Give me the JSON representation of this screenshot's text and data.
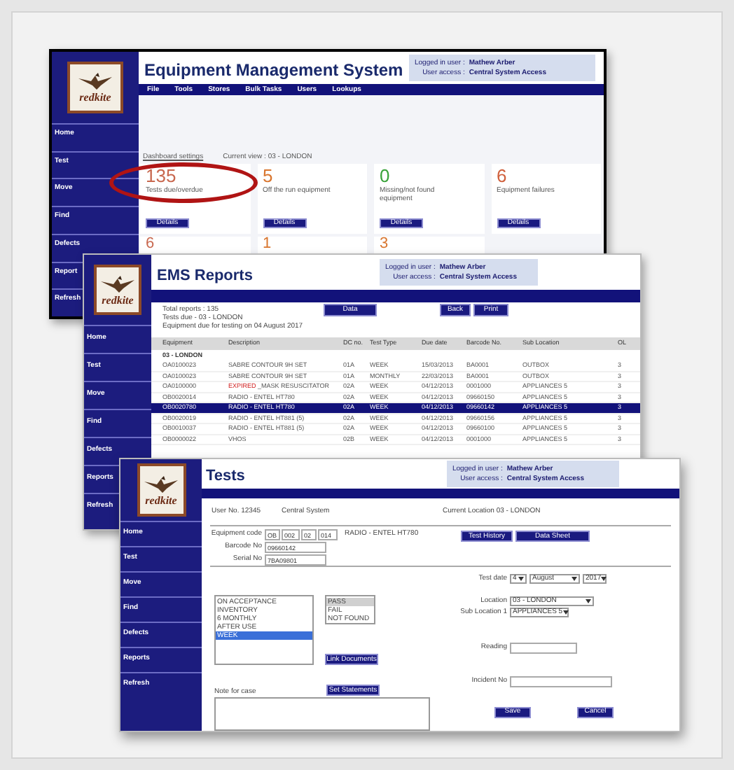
{
  "dashboard": {
    "logo_text": "redkite",
    "title": "Equipment Management System",
    "menu": [
      "File",
      "Tools",
      "Stores",
      "Bulk Tasks",
      "Users",
      "Lookups"
    ],
    "login": [
      {
        "label": "Logged in user :",
        "value": "Mathew Arber"
      },
      {
        "label": "User access :",
        "value": "Central System Access"
      }
    ],
    "sidebar": [
      "Home",
      "Test",
      "Move",
      "Find",
      "Defects",
      "Report",
      "Refresh"
    ],
    "settings_link": "Dashboard settings",
    "current_view": "Current view : 03 - LONDON",
    "cards": [
      {
        "value": "135",
        "label": "Tests due/overdue",
        "button": "Details",
        "color": "#c8684f"
      },
      {
        "value": "5",
        "label": "Off the run equipment",
        "button": "Details",
        "color": "#d9762f"
      },
      {
        "value": "0",
        "label": "Missing/not found equipment",
        "button": "Details",
        "color": "#3aa33a"
      },
      {
        "value": "6",
        "label": "Equipment failures",
        "button": "Details",
        "color": "#d0603c"
      }
    ],
    "cards_row2": [
      {
        "value": "6",
        "color": "#c8684f"
      },
      {
        "value": "1",
        "color": "#d9762f"
      },
      {
        "value": "3",
        "color": "#d9762f"
      }
    ]
  },
  "reports": {
    "logo_text": "redkite",
    "title": "EMS Reports",
    "login": [
      {
        "label": "Logged in user :",
        "value": "Mathew Arber"
      },
      {
        "label": "User access :",
        "value": "Central System Access"
      }
    ],
    "sidebar": [
      "Home",
      "Test",
      "Move",
      "Find",
      "Defects",
      "Reports",
      "Refresh"
    ],
    "summary": [
      "Total reports : 135",
      "Tests due - 03 - LONDON",
      "Equipment due for testing on 04 August 2017"
    ],
    "buttons": [
      "Data",
      "Back",
      "Print"
    ],
    "table": {
      "columns": [
        "Equipment",
        "Description",
        "DC no.",
        "Test Type",
        "Due date",
        "Barcode No.",
        "Sub Location",
        "OL"
      ],
      "group": "03 - LONDON",
      "rows": [
        {
          "cells": [
            "OA0100023",
            "SABRE CONTOUR 9H SET",
            "01A",
            "WEEK",
            "15/03/2013",
            "BA0001",
            "OUTBOX",
            "3"
          ],
          "selected": false
        },
        {
          "cells": [
            "OA0100023",
            "SABRE CONTOUR 9H SET",
            "01A",
            "MONTHLY",
            "22/03/2013",
            "BA0001",
            "OUTBOX",
            "3"
          ],
          "selected": false
        },
        {
          "cells": [
            "OA0100000",
            "_MASK RESUSCITATOR",
            "02A",
            "WEEK",
            "04/12/2013",
            "0001000",
            "APPLIANCES 5",
            "3"
          ],
          "flag": "EXPIRED",
          "selected": false
        },
        {
          "cells": [
            "OB0020014",
            "RADIO - ENTEL HT780",
            "02A",
            "WEEK",
            "04/12/2013",
            "09660150",
            "APPLIANCES 5",
            "3"
          ],
          "selected": false
        },
        {
          "cells": [
            "OB0020780",
            "RADIO - ENTEL HT780",
            "02A",
            "WEEK",
            "04/12/2013",
            "09660142",
            "APPLIANCES 5",
            "3"
          ],
          "selected": true
        },
        {
          "cells": [
            "OB0020019",
            "RADIO - ENTEL HT881 (5)",
            "02A",
            "WEEK",
            "04/12/2013",
            "09660156",
            "APPLIANCES 5",
            "3"
          ],
          "selected": false
        },
        {
          "cells": [
            "OB0010037",
            "RADIO - ENTEL HT881 (5)",
            "02A",
            "WEEK",
            "04/12/2013",
            "09660100",
            "APPLIANCES 5",
            "3"
          ],
          "selected": false
        },
        {
          "cells": [
            "OB0000022",
            "VHOS",
            "02B",
            "WEEK",
            "04/12/2013",
            "0001000",
            "APPLIANCES 5",
            "3"
          ],
          "selected": false
        }
      ]
    }
  },
  "tests": {
    "logo_text": "redkite",
    "title": "Tests",
    "login": [
      {
        "label": "Logged in user :",
        "value": "Mathew Arber"
      },
      {
        "label": "User access :",
        "value": "Central System Access"
      }
    ],
    "sidebar": [
      "Home",
      "Test",
      "Move",
      "Find",
      "Defects",
      "Reports",
      "Refresh"
    ],
    "user_no": "User No. 12345",
    "system": "Central System",
    "current_location": "Current Location 03 - LONDON",
    "equipment_code": {
      "label": "Equipment code",
      "parts": [
        "OB",
        "002",
        "02",
        "014"
      ],
      "description": "RADIO - ENTEL HT780"
    },
    "fields": [
      {
        "label": "Barcode No",
        "value": "09660142"
      },
      {
        "label": "Serial No",
        "value": "7BA09801"
      }
    ],
    "top_buttons": [
      "Test History",
      "Data Sheet"
    ],
    "test_date": {
      "label": "Test date",
      "selects": [
        "4",
        "August",
        "2017"
      ]
    },
    "test_types": [
      {
        "label": "ON ACCEPTANCE",
        "selected": false
      },
      {
        "label": "INVENTORY",
        "selected": false
      },
      {
        "label": "6 MONTHLY",
        "selected": false
      },
      {
        "label": "AFTER USE",
        "selected": false
      },
      {
        "label": "WEEK",
        "selected": true
      }
    ],
    "results": [
      {
        "label": "PASS",
        "selected": true
      },
      {
        "label": "FAIL",
        "selected": false
      },
      {
        "label": "NOT FOUND",
        "selected": false
      }
    ],
    "location": {
      "label": "Location",
      "value": "03 - LONDON"
    },
    "sub_location": {
      "label": "Sub Location 1",
      "value": "APPLIANCES 5"
    },
    "link_button": "Link Documents",
    "set_button": "Set Statements",
    "reading": {
      "label": "Reading"
    },
    "incident": {
      "label": "Incident No"
    },
    "note": {
      "label": "Note for case"
    },
    "actions": [
      "Save",
      "Cancel"
    ]
  }
}
